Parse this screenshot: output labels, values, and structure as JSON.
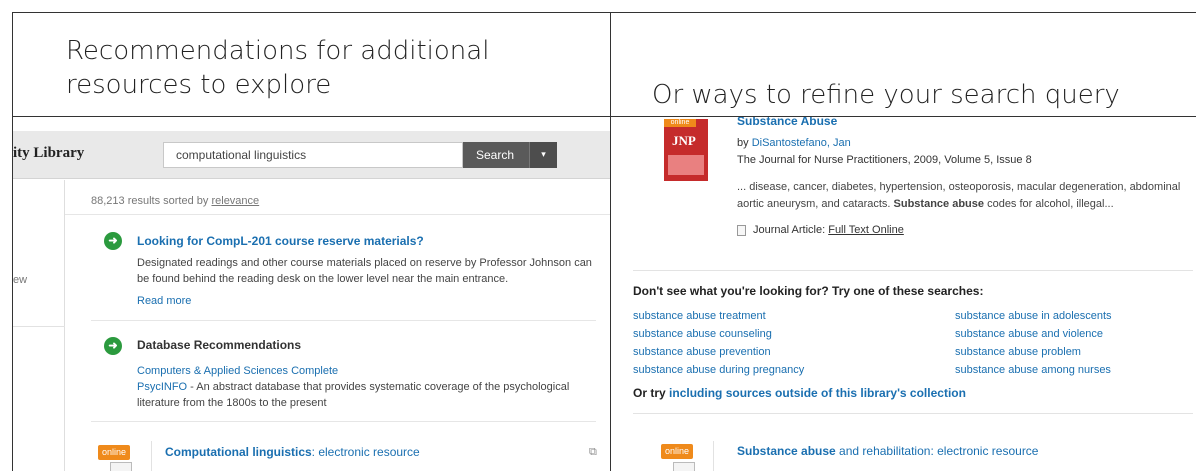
{
  "headings": {
    "left": "Recommendations for additional resources to explore",
    "right": "Or ways to refine your search query"
  },
  "left_screenshot": {
    "library_name": "ity Library",
    "search": {
      "value": "computational linguistics",
      "button_label": "Search",
      "dropdown_glyph": "▾"
    },
    "sidebar_fragment": "ew",
    "results_summary": {
      "prefix": "88,213 results sorted by",
      "sort_label": "relevance"
    },
    "recommendations": [
      {
        "title": "Looking for CompL-201 course reserve materials?",
        "body": "Designated readings and other course materials placed on reserve by Professor Johnson can be found behind the reading desk on the lower level near the main entrance.",
        "link": "Read more"
      },
      {
        "title": "Database Recommendations",
        "databases": [
          {
            "name": "Computers & Applied Sciences Complete",
            "description": ""
          },
          {
            "name": "PsycINFO",
            "description": " - An abstract database that provides systematic coverage of the psychological literature from the 1800s to the present"
          }
        ]
      }
    ],
    "result_item": {
      "badge": "online",
      "title_bold": "Computational linguistics",
      "title_rest": ": electronic resource"
    }
  },
  "right_screenshot": {
    "article": {
      "badge": "online",
      "cover_text": "JNP",
      "title": "Substance Abuse",
      "author_prefix": "by",
      "author": "DiSantostefano, Jan",
      "source": "The Journal for Nurse Practitioners, 2009, Volume 5, Issue 8",
      "snippet_start": "... disease, cancer, diabetes, hypertension, osteoporosis, macular degeneration, abdominal aortic aneurysm, and cataracts.",
      "snippet_bold": "Substance abuse",
      "snippet_end": "codes for alcohol, illegal...",
      "type_label": "Journal Article:",
      "fulltext_label": "Full Text Online"
    },
    "suggestions": {
      "heading": "Don't see what you're looking for? Try one of these searches:",
      "left_column": [
        "substance abuse treatment",
        "substance abuse counseling",
        "substance abuse prevention",
        "substance abuse during pregnancy"
      ],
      "right_column": [
        "substance abuse in adolescents",
        "substance abuse and violence",
        "substance abuse problem",
        "substance abuse among nurses"
      ],
      "or_try_prefix": "Or try",
      "or_try_link": "including sources outside of this library's collection"
    },
    "result_item": {
      "badge": "online",
      "title_bold": "Substance abuse",
      "title_rest": " and rehabilitation: electronic resource"
    }
  },
  "colors": {
    "link": "#1a6fb0",
    "badge": "#ef8a1b",
    "go_icon": "#2b9a3e",
    "search_button": "#5a5a5a"
  }
}
